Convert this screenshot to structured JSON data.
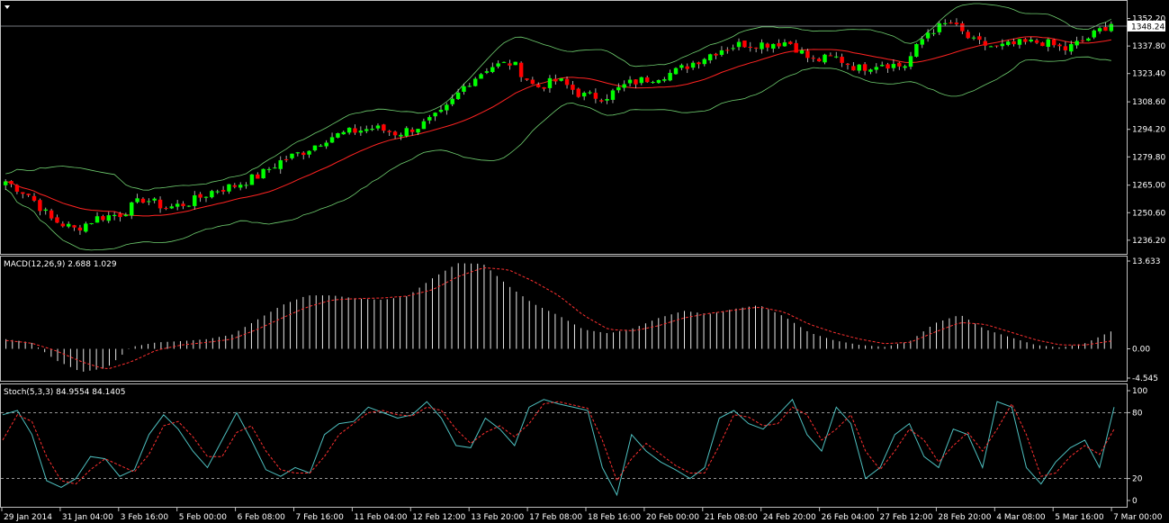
{
  "chart_data": [
    {
      "panel": "price",
      "type": "candlestick",
      "ylim": [
        1230,
        1360
      ],
      "price_ticks": [
        "1352.20",
        "1337.80",
        "1323.40",
        "1308.60",
        "1294.20",
        "1279.80",
        "1265.00",
        "1250.60",
        "1236.20"
      ],
      "current_price": "1348.24",
      "indicators": [
        "Bollinger Bands",
        "Moving Average"
      ],
      "colors": {
        "bull": "#00ff00",
        "bear": "#ff0000",
        "bands": "#6fce6f",
        "ma": "#ff2020",
        "axis": "#c0c0c0",
        "grid": "#ffffff"
      },
      "anchor_prices": [
        1267,
        1260,
        1247,
        1242,
        1248,
        1250,
        1258,
        1253,
        1256,
        1262,
        1265,
        1270,
        1278,
        1283,
        1290,
        1293,
        1295,
        1292,
        1296,
        1303,
        1318,
        1327,
        1329,
        1316,
        1320,
        1312,
        1311,
        1318,
        1321,
        1324,
        1330,
        1336,
        1339,
        1339,
        1340,
        1330,
        1332,
        1326,
        1329,
        1327,
        1345,
        1350,
        1340,
        1337,
        1339,
        1340,
        1336,
        1342,
        1350
      ]
    },
    {
      "panel": "macd",
      "type": "histogram",
      "label": "MACD(12,26,9) 2.688 1.029",
      "ylim": [
        -4.545,
        13.633
      ],
      "ticks": [
        "13.633",
        "0.00",
        "-4.545"
      ],
      "anchor_hist": [
        1.5,
        1.0,
        -1.8,
        -3.6,
        -3.0,
        0.3,
        1.0,
        1.2,
        1.5,
        2.2,
        4.5,
        6.8,
        8.3,
        8.3,
        7.8,
        7.6,
        8.2,
        11.0,
        13.3,
        13.2,
        9.8,
        7.0,
        5.2,
        3.0,
        2.4,
        3.2,
        4.8,
        5.9,
        5.4,
        6.2,
        6.8,
        5.0,
        2.5,
        1.3,
        0.6,
        0.3,
        1.2,
        4.0,
        5.3,
        3.0,
        1.8,
        0.6,
        0.2,
        0.9,
        2.7
      ],
      "anchor_signal": [
        1.3,
        0.9,
        -0.3,
        -2.0,
        -3.2,
        -2.0,
        -0.2,
        0.6,
        1.0,
        1.5,
        3.0,
        4.8,
        6.5,
        7.6,
        7.8,
        7.9,
        8.2,
        9.2,
        11.2,
        12.6,
        12.3,
        10.5,
        8.3,
        5.2,
        3.0,
        2.8,
        3.6,
        4.8,
        5.5,
        6.0,
        6.5,
        5.7,
        3.8,
        2.5,
        1.5,
        0.8,
        1.0,
        2.6,
        4.1,
        3.8,
        2.6,
        1.4,
        0.6,
        0.6,
        1.2
      ]
    },
    {
      "panel": "stochastic",
      "type": "line",
      "label": "Stoch(5,3,3) 84.9554 84.1405",
      "ylim": [
        0,
        100
      ],
      "ticks": [
        "100",
        "80",
        "20",
        "0"
      ],
      "levels": [
        80,
        20
      ],
      "series": [
        {
          "color": "#4ec0c0",
          "values": [
            78,
            82,
            60,
            18,
            12,
            20,
            40,
            38,
            22,
            28,
            60,
            78,
            65,
            45,
            30,
            55,
            80,
            55,
            28,
            22,
            30,
            25,
            60,
            70,
            72,
            85,
            80,
            75,
            78,
            90,
            75,
            50,
            48,
            75,
            65,
            50,
            85,
            92,
            88,
            85,
            82,
            30,
            5,
            60,
            45,
            35,
            28,
            20,
            30,
            75,
            82,
            70,
            65,
            78,
            92,
            60,
            45,
            85,
            70,
            20,
            30,
            60,
            70,
            40,
            30,
            65,
            60,
            30,
            90,
            85,
            30,
            15,
            35,
            48,
            55,
            30,
            85
          ]
        },
        {
          "color": "#ff3030",
          "dashed": true,
          "values": [
            55,
            78,
            72,
            40,
            18,
            15,
            28,
            38,
            32,
            26,
            42,
            68,
            72,
            58,
            40,
            40,
            62,
            68,
            45,
            28,
            25,
            25,
            40,
            60,
            70,
            80,
            82,
            78,
            77,
            85,
            82,
            65,
            52,
            62,
            68,
            58,
            70,
            88,
            90,
            87,
            84,
            55,
            18,
            38,
            52,
            42,
            32,
            25,
            25,
            50,
            78,
            76,
            68,
            70,
            85,
            78,
            55,
            65,
            78,
            45,
            28,
            45,
            65,
            55,
            35,
            50,
            62,
            45,
            65,
            88,
            60,
            22,
            25,
            40,
            50,
            42,
            65
          ]
        }
      ]
    }
  ],
  "x_axis": {
    "labels": [
      "29 Jan 2014",
      "31 Jan 04:00",
      "3 Feb 16:00",
      "5 Feb 00:00",
      "6 Feb 08:00",
      "7 Feb 16:00",
      "11 Feb 04:00",
      "12 Feb 12:00",
      "13 Feb 20:00",
      "17 Feb 08:00",
      "18 Feb 16:00",
      "20 Feb 00:00",
      "21 Feb 08:00",
      "24 Feb 20:00",
      "26 Feb 04:00",
      "27 Feb 12:00",
      "28 Feb 20:00",
      "4 Mar 08:00",
      "5 Mar 16:00",
      "7 Mar 00:00"
    ]
  }
}
